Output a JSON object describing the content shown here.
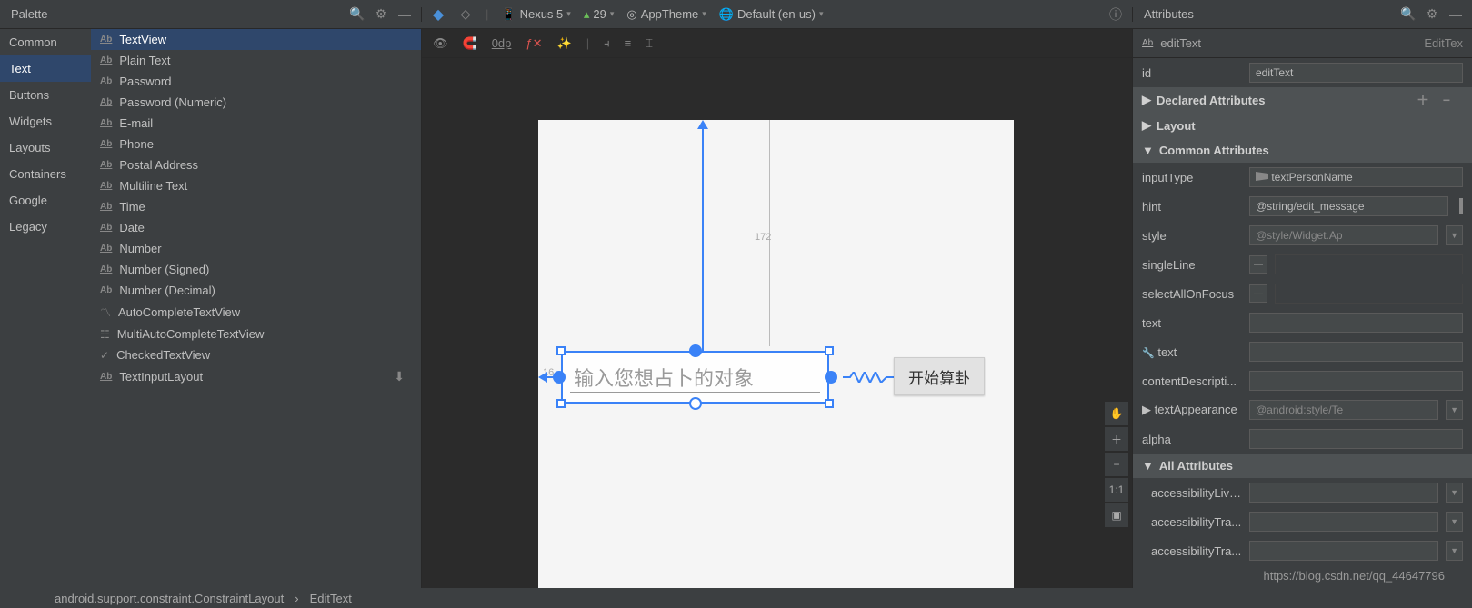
{
  "palette": {
    "title": "Palette",
    "categories": [
      "Common",
      "Text",
      "Buttons",
      "Widgets",
      "Layouts",
      "Containers",
      "Google",
      "Legacy"
    ],
    "selectedCategory": "Text",
    "items": [
      "TextView",
      "Plain Text",
      "Password",
      "Password (Numeric)",
      "E-mail",
      "Phone",
      "Postal Address",
      "Multiline Text",
      "Time",
      "Date",
      "Number",
      "Number (Signed)",
      "Number (Decimal)",
      "AutoCompleteTextView",
      "MultiAutoCompleteTextView",
      "CheckedTextView",
      "TextInputLayout"
    ],
    "selectedItem": "TextView"
  },
  "deviceBar": {
    "device": "Nexus 5",
    "api": "29",
    "theme": "AppTheme",
    "locale": "Default (en-us)"
  },
  "designToolbar": {
    "margin": "0dp"
  },
  "canvas": {
    "editText_hint": "输入您想占卜的对象",
    "button_label": "开始算卦",
    "measure_top": "172",
    "measure_left": "16"
  },
  "breadcrumb": {
    "root": "android.support.constraint.ConstraintLayout",
    "leaf": "EditText"
  },
  "attributes": {
    "title": "Attributes",
    "type_icon": "Ab",
    "type": "editText",
    "type_right": "EditTex",
    "id_label": "id",
    "id_value": "editText",
    "sections": {
      "declared": "Declared Attributes",
      "layout": "Layout",
      "common": "Common Attributes",
      "all": "All Attributes"
    },
    "common_attrs": {
      "inputType": {
        "label": "inputType",
        "value": "textPersonName"
      },
      "hint": {
        "label": "hint",
        "value": "@string/edit_message"
      },
      "style": {
        "label": "style",
        "value": "@style/Widget.Ap"
      },
      "singleLine": {
        "label": "singleLine"
      },
      "selectAllOnFocus": {
        "label": "selectAllOnFocus"
      },
      "text": {
        "label": "text"
      },
      "text2": {
        "label": "text"
      },
      "contentDescription": {
        "label": "contentDescripti..."
      },
      "textAppearance": {
        "label": "textAppearance",
        "value": "@android:style/Te"
      },
      "alpha": {
        "label": "alpha"
      }
    },
    "all_attrs": [
      "accessibilityLive...",
      "accessibilityTra...",
      "accessibilityTra..."
    ]
  },
  "watermark": "https://blog.csdn.net/qq_44647796"
}
